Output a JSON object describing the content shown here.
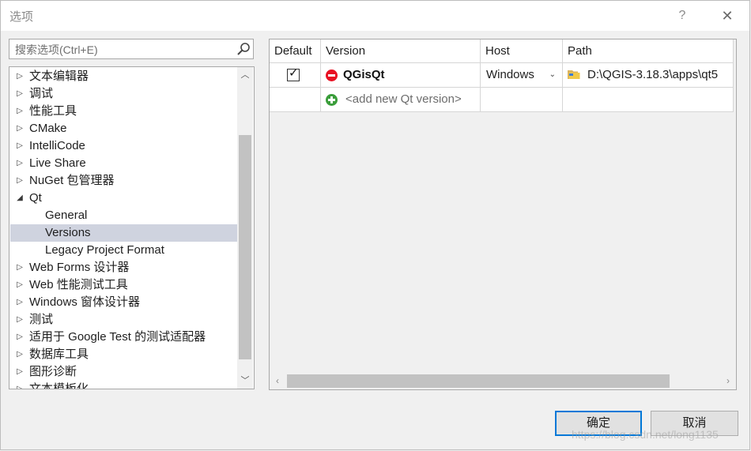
{
  "window": {
    "title": "选项",
    "help": "?",
    "close": "✕"
  },
  "search": {
    "placeholder": "搜索选项(Ctrl+E)",
    "value": ""
  },
  "tree": {
    "items": [
      {
        "label": "文本编辑器",
        "arrow": "▷"
      },
      {
        "label": "调试",
        "arrow": "▷"
      },
      {
        "label": "性能工具",
        "arrow": "▷"
      },
      {
        "label": "CMake",
        "arrow": "▷"
      },
      {
        "label": "IntelliCode",
        "arrow": "▷"
      },
      {
        "label": "Live Share",
        "arrow": "▷"
      },
      {
        "label": "NuGet 包管理器",
        "arrow": "▷"
      },
      {
        "label": "Qt",
        "arrow": "◢"
      },
      {
        "label": "General",
        "arrow": ""
      },
      {
        "label": "Versions",
        "arrow": ""
      },
      {
        "label": "Legacy Project Format",
        "arrow": ""
      },
      {
        "label": "Web Forms 设计器",
        "arrow": "▷"
      },
      {
        "label": "Web 性能测试工具",
        "arrow": "▷"
      },
      {
        "label": "Windows 窗体设计器",
        "arrow": "▷"
      },
      {
        "label": "测试",
        "arrow": "▷"
      },
      {
        "label": "适用于 Google Test 的测试适配器",
        "arrow": "▷"
      },
      {
        "label": "数据库工具",
        "arrow": "▷"
      },
      {
        "label": "图形诊断",
        "arrow": "▷"
      },
      {
        "label": "文本模板化",
        "arrow": "▷"
      }
    ],
    "selected": "Versions",
    "scroll_up": "︿",
    "scroll_down": "﹀"
  },
  "grid": {
    "headers": {
      "default": "Default",
      "version": "Version",
      "host": "Host",
      "path": "Path"
    },
    "rows": [
      {
        "default_checked": true,
        "check_mark": "✓",
        "version": "QGisQt",
        "host": "Windows",
        "host_dd": "⌄",
        "path": "D:\\QGIS-3.18.3\\apps\\qt5"
      }
    ],
    "add_row": {
      "label": "<add new Qt version>"
    },
    "scroll_left": "‹",
    "scroll_right": "›"
  },
  "buttons": {
    "ok": "确定",
    "cancel": "取消"
  },
  "watermark": "https://blog.csdn.net/long1135",
  "colors": {
    "accent": "#0078d7",
    "selected_row": "#cfd3df",
    "remove": "#e81123",
    "add": "#3a9d3a"
  }
}
